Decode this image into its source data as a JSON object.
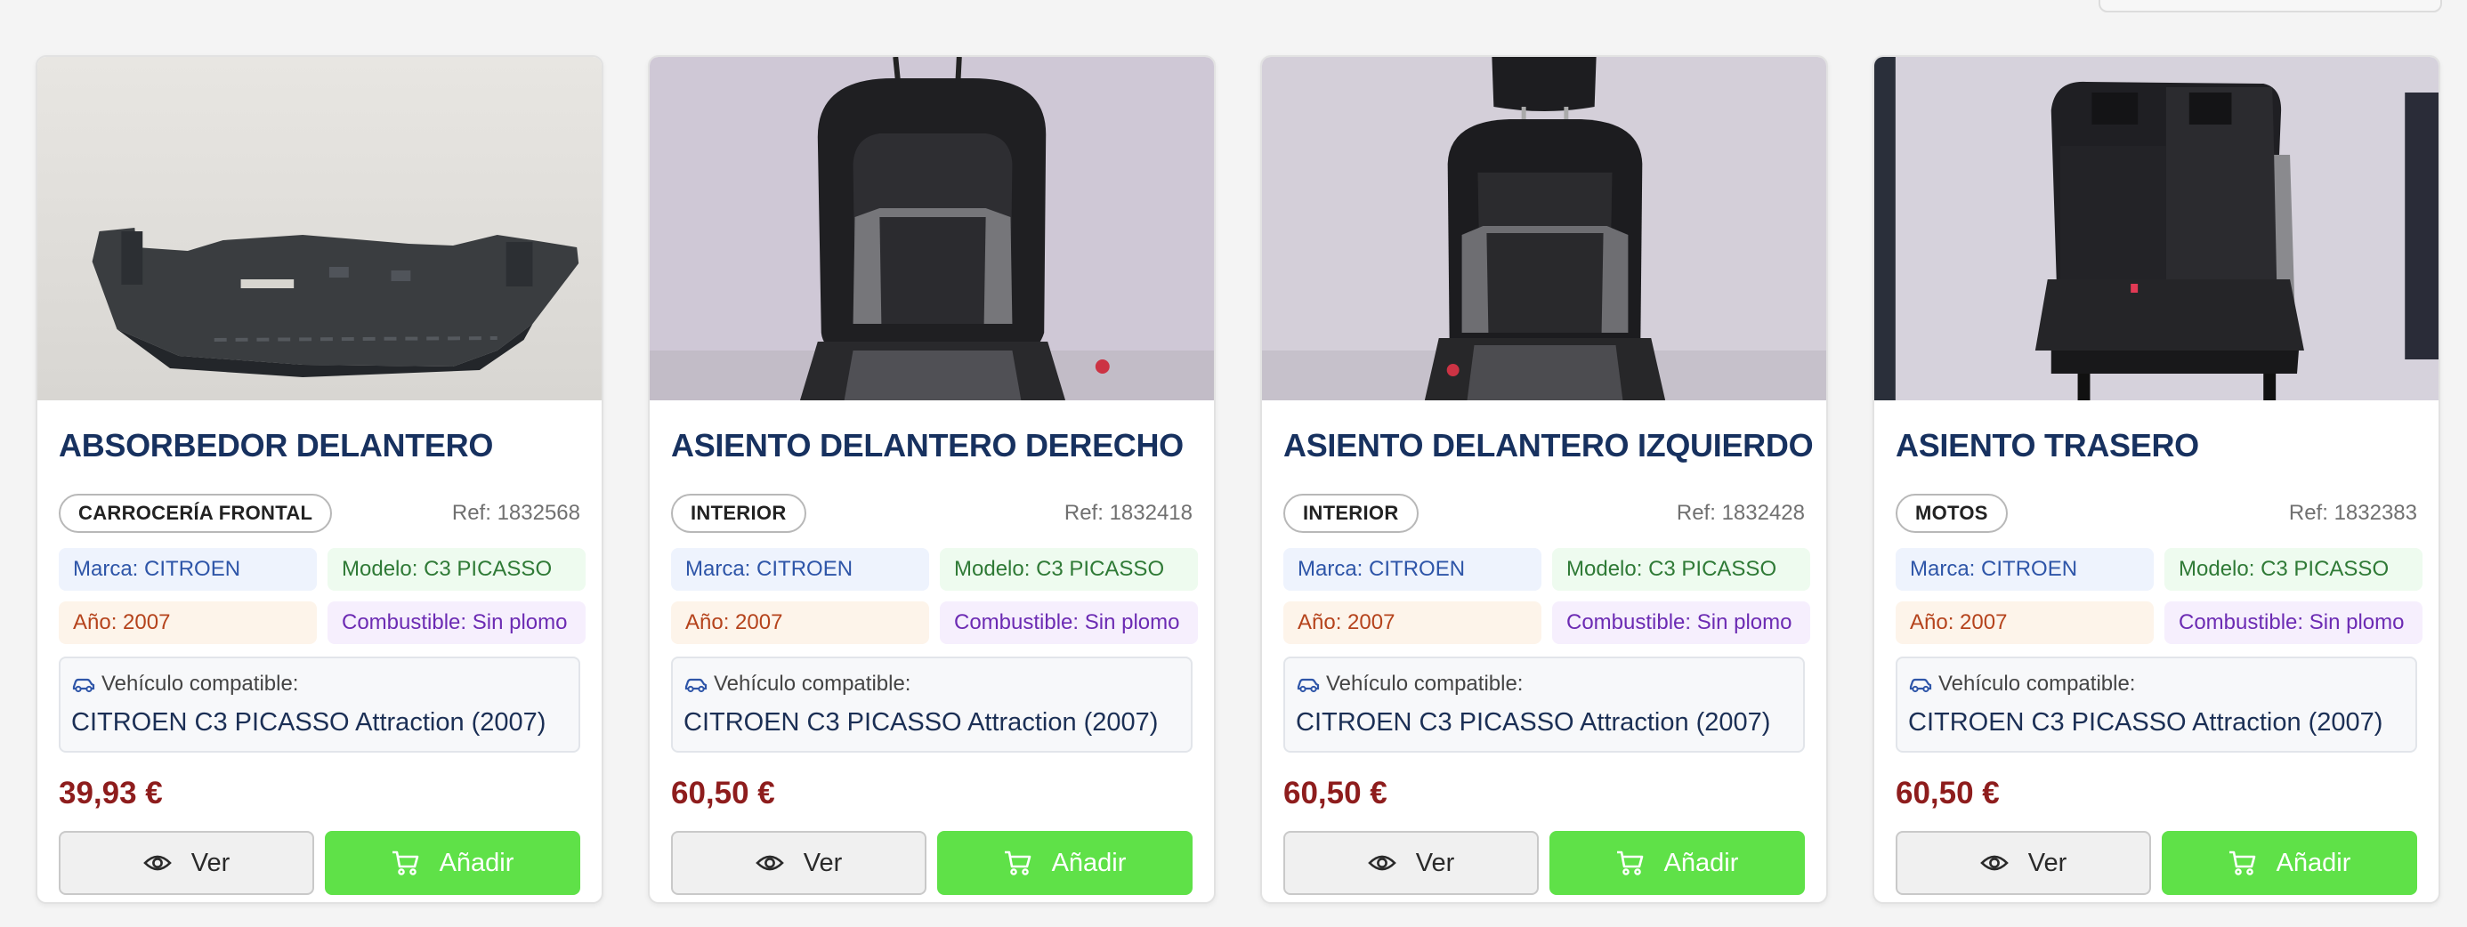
{
  "labels": {
    "marca": "Marca:",
    "modelo": "Modelo:",
    "ano": "Año:",
    "combustible": "Combustible:",
    "compatible": "Vehículo compatible:",
    "ref": "Ref:",
    "view_button": "Ver",
    "add_button": "Añadir"
  },
  "colors": {
    "title": "#17315f",
    "price": "#8e1d1d",
    "add_button": "#5fe148"
  },
  "icons": {
    "view": "eye-icon",
    "add": "cart-icon",
    "compatible": "car-icon"
  },
  "products": [
    {
      "title": "ABSORBEDOR DELANTERO",
      "category": "CARROCERÍA FRONTAL",
      "ref": "1832568",
      "marca": "CITROEN",
      "modelo": "C3 PICASSO",
      "ano": "2007",
      "combustible": "Sin plomo",
      "compatible_vehicle": "CITROEN C3 PICASSO Attraction (2007)",
      "price": "39,93 €",
      "image": "bumper-absorber-photo"
    },
    {
      "title": "ASIENTO DELANTERO DERECHO",
      "category": "INTERIOR",
      "ref": "1832418",
      "marca": "CITROEN",
      "modelo": "C3 PICASSO",
      "ano": "2007",
      "combustible": "Sin plomo",
      "compatible_vehicle": "CITROEN C3 PICASSO Attraction (2007)",
      "price": "60,50 €",
      "image": "front-right-seat-photo"
    },
    {
      "title": "ASIENTO DELANTERO IZQUIERDO",
      "category": "INTERIOR",
      "ref": "1832428",
      "marca": "CITROEN",
      "modelo": "C3 PICASSO",
      "ano": "2007",
      "combustible": "Sin plomo",
      "compatible_vehicle": "CITROEN C3 PICASSO Attraction (2007)",
      "price": "60,50 €",
      "image": "front-left-seat-photo"
    },
    {
      "title": "ASIENTO TRASERO",
      "category": "MOTOS",
      "ref": "1832383",
      "marca": "CITROEN",
      "modelo": "C3 PICASSO",
      "ano": "2007",
      "combustible": "Sin plomo",
      "compatible_vehicle": "CITROEN C3 PICASSO Attraction (2007)",
      "price": "60,50 €",
      "image": "rear-seat-photo"
    }
  ]
}
